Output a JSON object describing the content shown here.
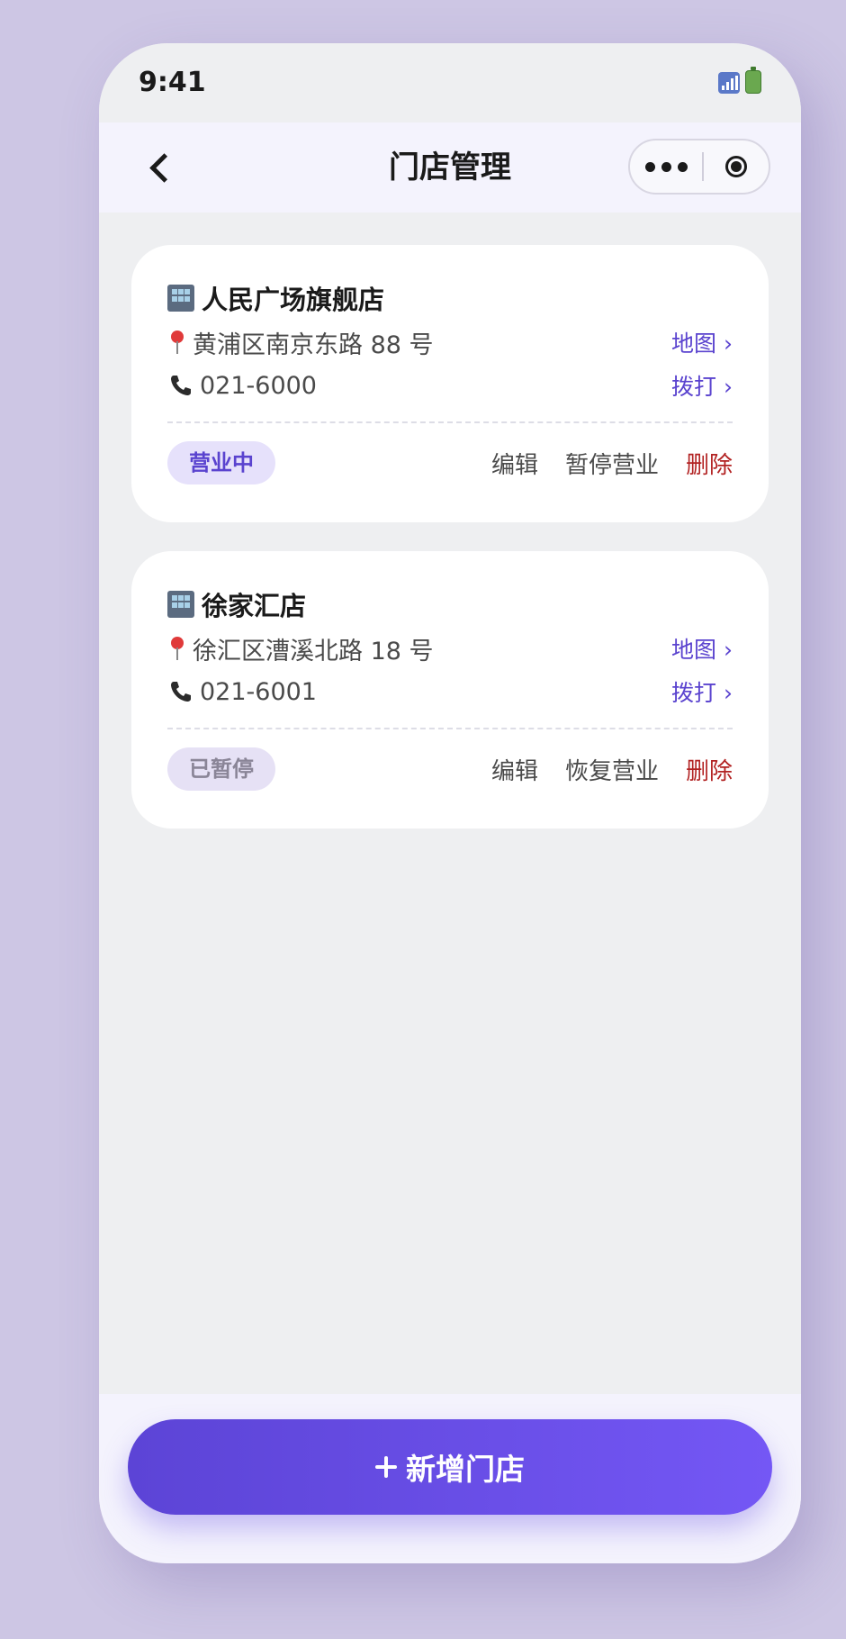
{
  "status_bar": {
    "time": "9:41",
    "icons": [
      "signal-icon",
      "battery-icon"
    ]
  },
  "nav": {
    "title": "门店管理",
    "icons": [
      "chevron-left-icon",
      "more-dots-icon",
      "close-target-icon"
    ]
  },
  "stores": [
    {
      "name": "人民广场旗舰店",
      "address": "黄浦区南京东路 88 号",
      "phone": "021-6000",
      "map_link": "地图 ›",
      "call_link": "拨打 ›",
      "status": "营业中",
      "actions": {
        "edit": "编辑",
        "toggle": "暂停营业",
        "delete": "删除"
      }
    },
    {
      "name": "徐家汇店",
      "address": "徐汇区漕溪北路 18 号",
      "phone": "021-6001",
      "map_link": "地图 ›",
      "call_link": "拨打 ›",
      "status": "已暂停",
      "actions": {
        "edit": "编辑",
        "toggle": "恢复营业",
        "delete": "删除"
      }
    }
  ],
  "bottom": {
    "add_button_label": "新增门店"
  },
  "colors": {
    "accent": "#5a43cf",
    "delete": "#b22222",
    "badge_open_bg": "#e6e1fb",
    "badge_paused_bg": "#e6e1f5",
    "button_gradient_start": "#5c44d6",
    "button_gradient_end": "#7457f5"
  }
}
